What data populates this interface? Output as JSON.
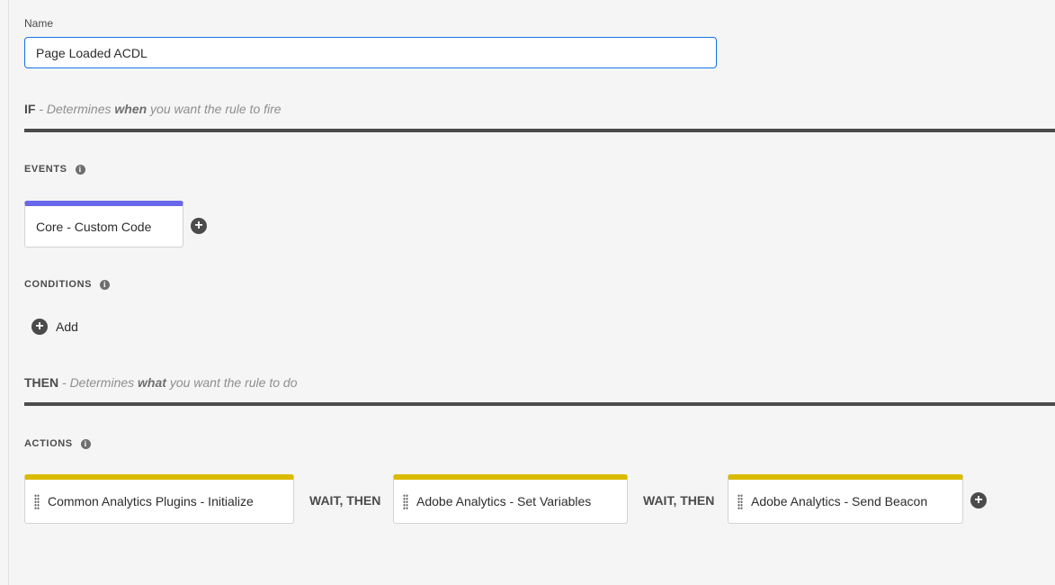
{
  "name_field": {
    "label": "Name",
    "value": "Page Loaded ACDL"
  },
  "if_section": {
    "keyword": "IF",
    "desc_prefix": " - Determines ",
    "desc_bold": "when",
    "desc_suffix": " you want the rule to fire"
  },
  "events": {
    "label": "EVENTS",
    "items": [
      {
        "label": "Core - Custom Code"
      }
    ]
  },
  "conditions": {
    "label": "CONDITIONS",
    "add_label": "Add"
  },
  "then_section": {
    "keyword": "THEN",
    "desc_prefix": " - Determines ",
    "desc_bold": "what",
    "desc_suffix": " you want the rule to do"
  },
  "actions": {
    "label": "ACTIONS",
    "items": [
      {
        "label": "Common Analytics Plugins - Initialize"
      },
      {
        "label": "Adobe Analytics - Set Variables"
      },
      {
        "label": "Adobe Analytics - Send Beacon"
      }
    ],
    "separator": "WAIT, THEN"
  },
  "colors": {
    "event_accent": "#6767ec",
    "action_accent": "#d9bb00",
    "focus": "#1473e6"
  }
}
